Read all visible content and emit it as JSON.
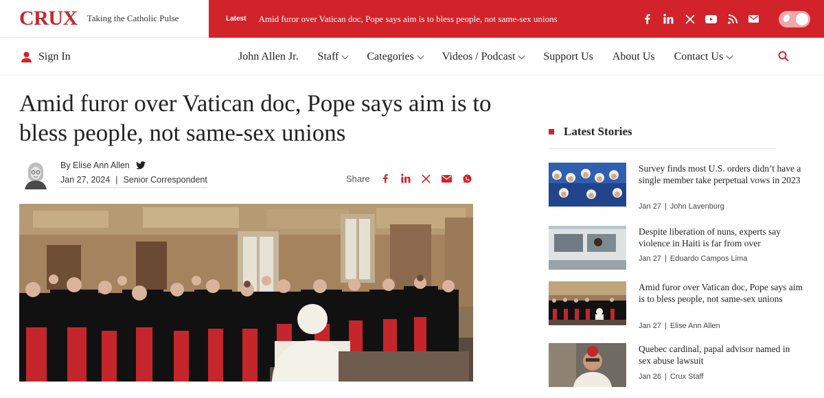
{
  "brand": {
    "logo": "CRUX",
    "tagline": "Taking the Catholic Pulse"
  },
  "ticker": {
    "tag": "Latest",
    "headline": "Amid furor over Vatican doc, Pope says aim is to bless people, not same-sex unions"
  },
  "social_icons": [
    "facebook-icon",
    "linkedin-icon",
    "x-icon",
    "youtube-icon",
    "rss-icon",
    "mail-icon"
  ],
  "colors": {
    "accent": "#d2232a"
  },
  "nav": {
    "signin": "Sign In",
    "items": [
      {
        "label": "John Allen Jr.",
        "dropdown": false
      },
      {
        "label": "Staff",
        "dropdown": true
      },
      {
        "label": "Categories",
        "dropdown": true
      },
      {
        "label": "Videos / Podcast",
        "dropdown": true
      },
      {
        "label": "Support Us",
        "dropdown": false
      },
      {
        "label": "About Us",
        "dropdown": false
      },
      {
        "label": "Contact Us",
        "dropdown": true
      }
    ]
  },
  "article": {
    "title": "Amid furor over Vatican doc, Pope says aim is to bless people, not same-sex unions",
    "author": "By Elise Ann Allen",
    "date": "Jan 27, 2024",
    "role": "Senior Correspondent",
    "share_label": "Share"
  },
  "sidebar": {
    "heading": "Latest Stories",
    "stories": [
      {
        "title": "Survey finds most U.S. orders didn’t have a single member take perpetual vows in 2023",
        "date": "Jan 27",
        "author": "John Lavenburg"
      },
      {
        "title": "Despite liberation of nuns, experts say violence in Haiti is far from over",
        "date": "Jan 27",
        "author": "Eduardo Campos Lima"
      },
      {
        "title": "Amid furor over Vatican doc, Pope says aim is to bless people, not same-sex unions",
        "date": "Jan 27",
        "author": "Elise Ann Allen"
      },
      {
        "title": "Quebec cardinal, papal advisor named in sex abuse lawsuit",
        "date": "Jan 26",
        "author": "Crux Staff"
      }
    ]
  }
}
